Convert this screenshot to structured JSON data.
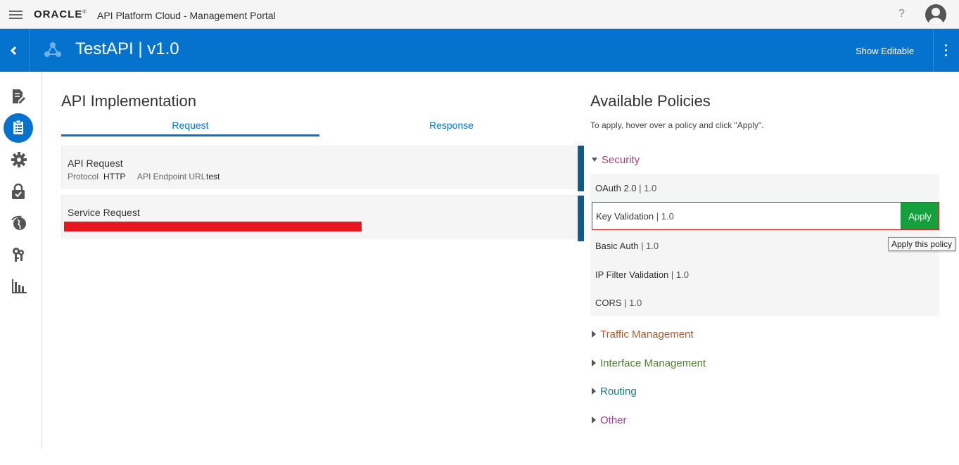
{
  "topbar": {
    "logo": "ORACLE",
    "app_title": "API Platform Cloud - Management Portal",
    "help": "?"
  },
  "header": {
    "api_title": "TestAPI | v1.0",
    "show_editable": "Show Editable",
    "color": "#0572ce"
  },
  "rail": {
    "items": [
      "document-edit-icon",
      "list-icon",
      "gear-icon",
      "lock-icon",
      "globe-icon",
      "keys-icon",
      "bar-chart-icon"
    ],
    "active_index": 1
  },
  "implementation": {
    "title": "API Implementation",
    "tabs": [
      "Request",
      "Response"
    ],
    "active_tab": "Request",
    "api_request": {
      "title": "API Request",
      "protocol_label": "Protocol",
      "protocol_value": "HTTP",
      "endpoint_label": "API Endpoint URL",
      "endpoint_value": "test"
    },
    "service_request": {
      "title": "Service Request",
      "error_color": "#e8161d"
    }
  },
  "policies": {
    "title": "Available Policies",
    "subtitle": "To apply, hover over a policy and click \"Apply\".",
    "groups": {
      "security": "Security",
      "traffic": "Traffic Management",
      "interface": "Interface Management",
      "routing": "Routing",
      "other": "Other"
    },
    "security_items": [
      {
        "name": "OAuth 2.0",
        "version": "| 1.0"
      },
      {
        "name": "Key Validation",
        "version": "| 1.0"
      },
      {
        "name": "Basic Auth",
        "version": "| 1.0"
      },
      {
        "name": "IP Filter Validation",
        "version": "| 1.0"
      },
      {
        "name": "CORS",
        "version": "| 1.0"
      }
    ],
    "apply_label": "Apply",
    "tooltip": "Apply this policy",
    "apply_color": "#14a03d"
  }
}
